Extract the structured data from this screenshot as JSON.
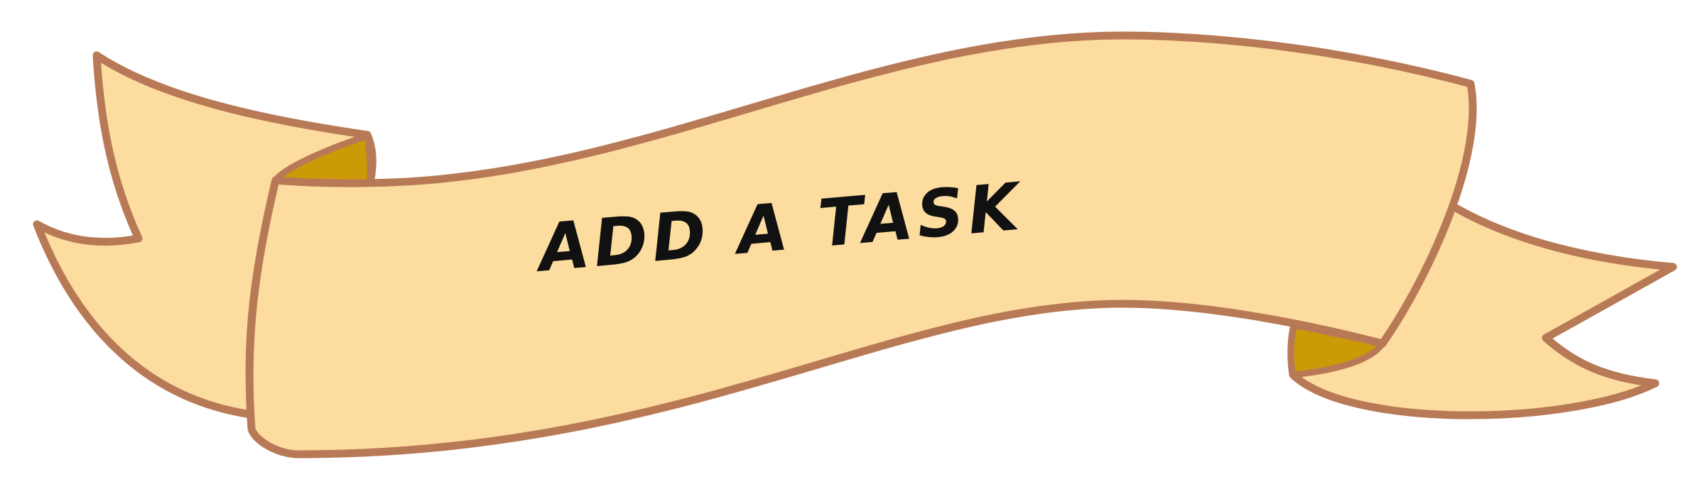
{
  "banner": {
    "label": "ADD A TASK",
    "colors": {
      "fill": "#FDDC9F",
      "outline": "#B87A56",
      "fold": "#CC9A06",
      "text": "#111111"
    }
  }
}
